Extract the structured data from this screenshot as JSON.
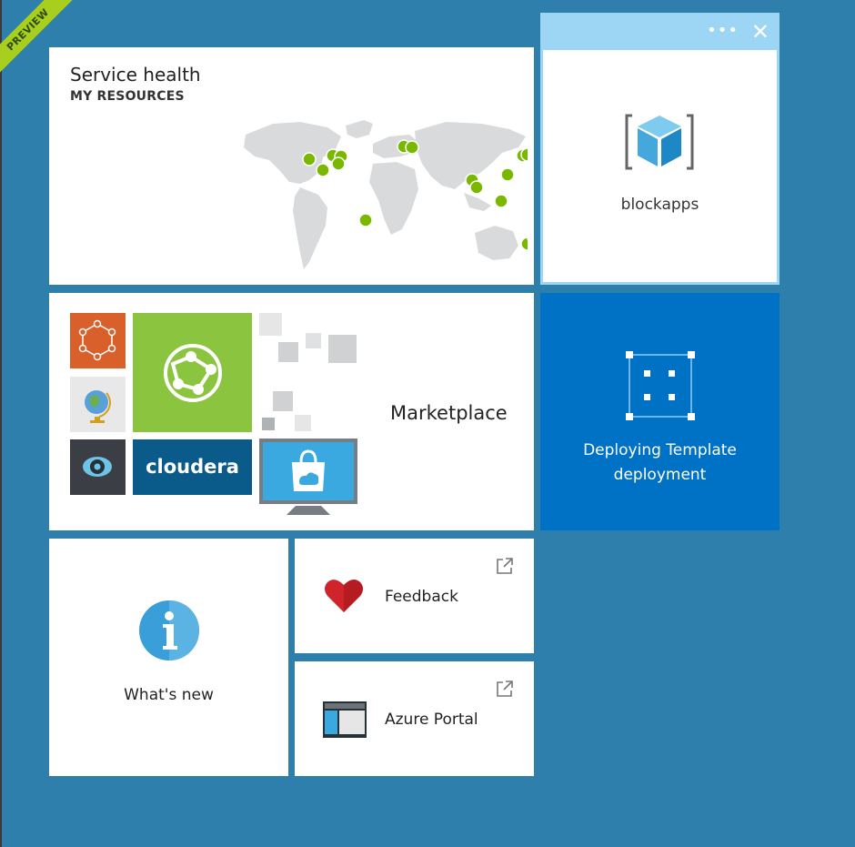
{
  "banner": {
    "text": "PREVIEW"
  },
  "service_health": {
    "title": "Service health",
    "subtitle": "MY RESOURCES"
  },
  "resource_tile": {
    "name": "blockapps",
    "menu_icon": "ellipsis-icon",
    "close_icon": "close-icon"
  },
  "marketplace": {
    "label": "Marketplace",
    "cloudera_logo_text": "cloudera"
  },
  "deployment": {
    "line1": "Deploying Template",
    "line2": "deployment"
  },
  "whats_new": {
    "label": "What's new"
  },
  "feedback": {
    "label": "Feedback"
  },
  "azure_portal": {
    "label": "Azure Portal"
  },
  "colors": {
    "background": "#2e7fac",
    "accent_blue": "#0072c6",
    "selected_border": "#9dd6f5",
    "preview_green": "#a9cf1e",
    "status_ok": "#7ab800"
  }
}
